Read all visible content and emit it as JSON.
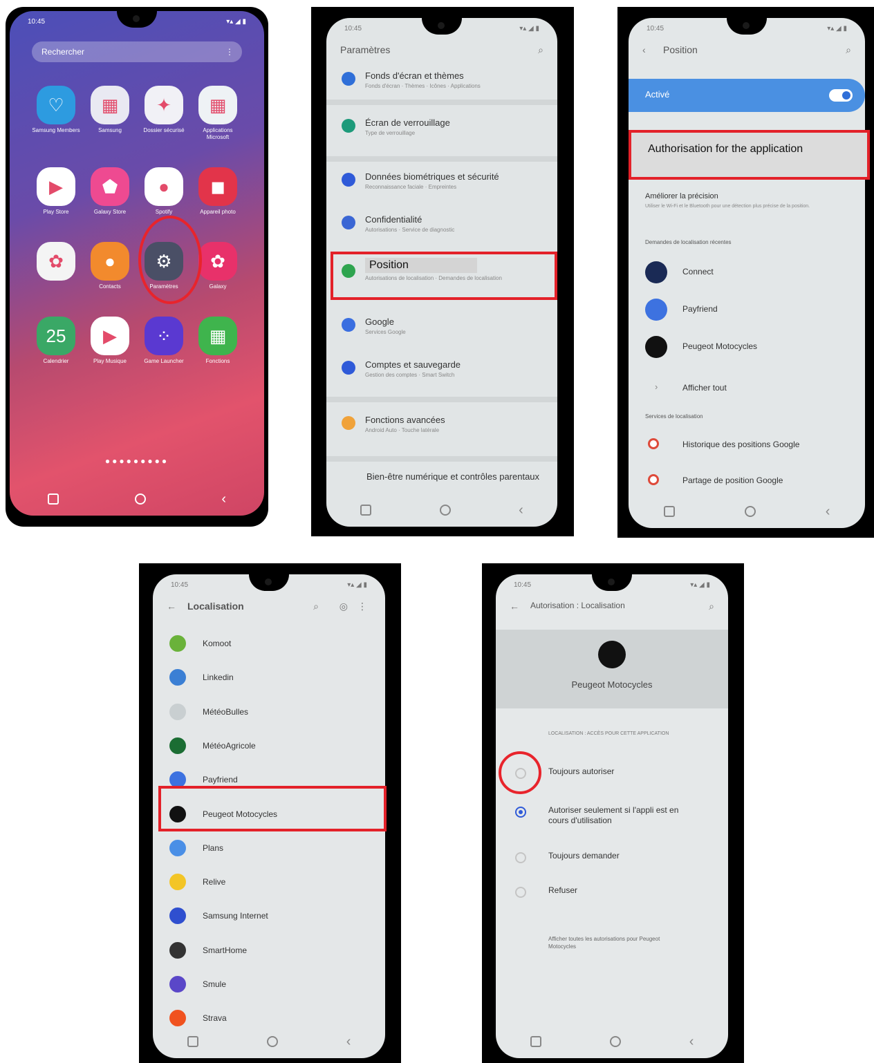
{
  "screens": {
    "home": {
      "search_label": "Rechercher",
      "menu_glyph": "⋮",
      "apps": [
        {
          "label": "Samsung Members",
          "icon": "samsung-members-icon",
          "color": "#2d9be0",
          "glyph": "♡"
        },
        {
          "label": "Samsung",
          "icon": "samsung-folder-icon",
          "color": "#e9e9f2",
          "glyph": "▦"
        },
        {
          "label": "Dossier sécurisé",
          "icon": "secure-folder-icon",
          "color": "#f1f1f6",
          "glyph": "✦"
        },
        {
          "label": "Applications Microsoft",
          "icon": "microsoft-folder-icon",
          "color": "#eef2f5",
          "glyph": "▦"
        },
        {
          "label": "Play Store",
          "icon": "play-store-icon",
          "color": "#ffffff",
          "glyph": "▶"
        },
        {
          "label": "Galaxy Store",
          "icon": "galaxy-store-icon",
          "color": "#ee4a91",
          "glyph": "⬟"
        },
        {
          "label": "Spotify",
          "icon": "spotify-icon",
          "color": "#ffffff",
          "glyph": "●"
        },
        {
          "label": "Appareil photo",
          "icon": "camera-icon",
          "color": "#e2344a",
          "glyph": "◼"
        },
        {
          "label": "",
          "icon": "photos-icon",
          "color": "#f4f4f4",
          "glyph": "✿"
        },
        {
          "label": "Contacts",
          "icon": "contacts-icon",
          "color": "#f28a2d",
          "glyph": "●"
        },
        {
          "label": "Paramètres",
          "icon": "settings-icon",
          "color": "#4a4f66",
          "glyph": "⚙"
        },
        {
          "label": "Galaxy",
          "icon": "galaxy-icon",
          "color": "#e8316a",
          "glyph": "✿"
        },
        {
          "label": "Calendrier",
          "icon": "calendar-icon",
          "color": "#3aa866",
          "glyph": "25"
        },
        {
          "label": "Play Musique",
          "icon": "play-music-icon",
          "color": "#ffffff",
          "glyph": "▶"
        },
        {
          "label": "Game Launcher",
          "icon": "game-launcher-icon",
          "color": "#5a39d1",
          "glyph": "⁘"
        },
        {
          "label": "Fonctions",
          "icon": "tools-folder-icon",
          "color": "#3fb44d",
          "glyph": "▦"
        }
      ],
      "page_dots": "●●●●●●●●●"
    },
    "settings": {
      "title": "Paramètres",
      "rows": [
        {
          "title": "Fonds d'écran et thèmes",
          "sub": "Fonds d'écran · Thèmes · Icônes · Applications",
          "color": "#2f6fd8"
        },
        {
          "title": "Écran de verrouillage",
          "sub": "Type de verrouillage",
          "color": "#1d9a7a"
        },
        {
          "title": "Données biométriques et sécurité",
          "sub": "Reconnaissance faciale · Empreintes",
          "color": "#2f5ad8"
        },
        {
          "title": "Confidentialité",
          "sub": "Autorisations · Service de diagnostic",
          "color": "#3a66d4"
        },
        {
          "title": "Position",
          "sub": "Autorisations de localisation · Demandes de localisation",
          "color": "#2ea44f"
        },
        {
          "title": "Google",
          "sub": "Services Google",
          "color": "#3a6ee0"
        },
        {
          "title": "Comptes et sauvegarde",
          "sub": "Gestion des comptes · Smart Switch",
          "color": "#2f5ad8"
        },
        {
          "title": "Fonctions avancées",
          "sub": "Android Auto · Touche latérale",
          "color": "#f0a23a"
        },
        {
          "title": "Bien-être numérique et contrôles parentaux",
          "sub": "",
          "color": ""
        }
      ],
      "highlight": "Position"
    },
    "position": {
      "title": "Position",
      "toggle_label": "Activé",
      "highlight": "Authorisation for the application",
      "accuracy_title": "Améliorer la précision",
      "accuracy_sub": "Utiliser le Wi-Fi et le Bluetooth pour une détection plus précise de la position.",
      "recent_header": "Demandes de localisation récentes",
      "recent": [
        {
          "label": "Connect",
          "color": "#1a2a55"
        },
        {
          "label": "Payfriend",
          "color": "#3d72e0"
        },
        {
          "label": "Peugeot Motocycles",
          "color": "#111111"
        }
      ],
      "show_all": "Afficher tout",
      "services_header": "Services de localisation",
      "services": [
        {
          "label": "Historique des positions Google"
        },
        {
          "label": "Partage de position Google"
        }
      ]
    },
    "localisation": {
      "title": "Localisation",
      "apps": [
        {
          "label": "Komoot",
          "color": "#6ab23a"
        },
        {
          "label": "Linkedin",
          "color": "#3b7fd4"
        },
        {
          "label": "MétéoBulles",
          "color": "#c9cfd1"
        },
        {
          "label": "MétéoAgricole",
          "color": "#1b6d33"
        },
        {
          "label": "Payfriend",
          "color": "#3d72e0"
        },
        {
          "label": "Peugeot Motocycles",
          "color": "#111111"
        },
        {
          "label": "Plans",
          "color": "#4a8fe6"
        },
        {
          "label": "Relive",
          "color": "#f3c526"
        },
        {
          "label": "Samsung Internet",
          "color": "#2f4fcf"
        },
        {
          "label": "SmartHome",
          "color": "#333333"
        },
        {
          "label": "Smule",
          "color": "#5a47c8"
        },
        {
          "label": "Strava",
          "color": "#f0521f"
        }
      ],
      "highlight": "Peugeot Motocycles"
    },
    "permission": {
      "title": "Autorisation : Localisation",
      "app_name": "Peugeot Motocycles",
      "section_header": "LOCALISATION : ACCÈS POUR CETTE APPLICATION",
      "options": [
        {
          "label": "Toujours autoriser",
          "selected": false
        },
        {
          "label": "Autoriser seulement si l'appli est en cours d'utilisation",
          "selected": true
        },
        {
          "label": "Toujours demander",
          "selected": false
        },
        {
          "label": "Refuser",
          "selected": false
        }
      ],
      "footer": "Afficher toutes les autorisations pour Peugeot Motocycles"
    }
  },
  "status": {
    "time": "10:45",
    "right": "▾▴ ◢ ▮"
  },
  "colors": {
    "highlight": "#e32129",
    "accent": "#2f5ad8",
    "toggle_bar": "#4a90e2"
  }
}
